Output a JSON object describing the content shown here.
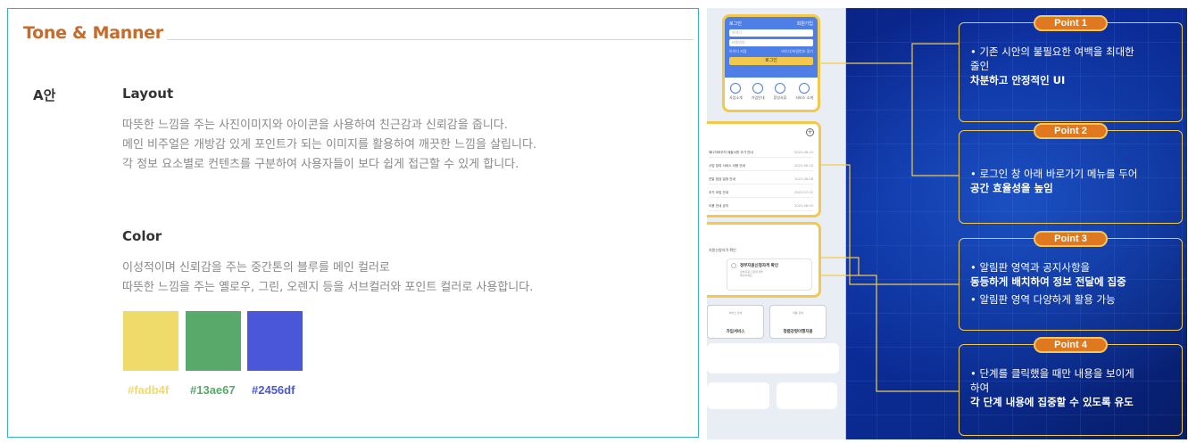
{
  "left": {
    "title": "Tone & Manner",
    "plan": "A안",
    "layout": {
      "heading": "Layout",
      "lines": [
        "따뜻한 느낌을 주는 사진이미지와 아이콘을 사용하여 친근감과 신뢰감을 줍니다.",
        "메인 비주얼은 개방감 있게 포인트가 되는 이미지를 활용하여 깨끗한 느낌을 살립니다.",
        "각 정보 요소별로 컨텐츠를 구분하여 사용자들이 보다 쉽게 접근할 수 있게 합니다."
      ]
    },
    "color": {
      "heading": "Color",
      "lines": [
        "이성적이며 신뢰감을 주는 중간톤의 블루를 메인 컬러로",
        "따뜻한 느낌을 주는 옐로우, 그린, 오렌지 등을 서브컬러와 포인트 컬러로 사용합니다."
      ],
      "swatches": [
        {
          "label": "#fadb4f",
          "color": "#efdb6a"
        },
        {
          "label": "#13ae67",
          "color": "#58a96a"
        },
        {
          "label": "#2456df",
          "color": "#4a57d9"
        }
      ]
    }
  },
  "right": {
    "login_card": {
      "title": "로그인",
      "signup": "회원가입",
      "id_placeholder": "아이디",
      "pw_placeholder": "비밀번호",
      "save_id": "아이디 저장",
      "find": "아이디/비밀번호 찾기",
      "login_button": "로그인",
      "shortcuts": [
        "사업소개",
        "가입안내",
        "증빙서류",
        "서비스 소개"
      ]
    },
    "notice_rows": [
      {
        "text": "에너지바우처 제출서류 추가 안내",
        "date": "2022-06-10"
      },
      {
        "text": "사업 참여 서비스 이용 안내",
        "date": "2022-06-10"
      },
      {
        "text": "연말 점검 일정 안내",
        "date": "2022-06-08"
      },
      {
        "text": "추가 모집 안내",
        "date": "2022-07-02"
      },
      {
        "text": "이용 안내 공지",
        "date": "2022-06-05"
      }
    ],
    "board": {
      "label": "지원신청자격 확인",
      "item_title": "정부지원신청자격 확인",
      "item_sub": [
        "정부지원 신청자격을",
        "확인하세요"
      ]
    },
    "services": [
      {
        "sub": "서비스 안내",
        "title": "가입서비스"
      },
      {
        "sub": "이용 안내",
        "title": "청렴강령이행지원"
      }
    ],
    "points": [
      {
        "label": "Point 1",
        "lines": [
          {
            "text": "• 기존 시안의 불필요한 여백을 최대한",
            "bold": false
          },
          {
            "text": "  줄인",
            "bold": false
          },
          {
            "text": "  차분하고 안정적인 UI",
            "bold": true
          }
        ]
      },
      {
        "label": "Point 2",
        "lines": [
          {
            "text": "• 로그인 창 아래 바로가기 메뉴를 두어",
            "bold": false
          },
          {
            "text": "  공간 효율성을 높임",
            "bold": false,
            "strong": "공간 효율성"
          }
        ]
      },
      {
        "label": "Point 3",
        "lines": [
          {
            "text": "• 알림판 영역과 공지사항을",
            "bold": false
          },
          {
            "text": "  동등하게 배치하여 정보 전달에 집중",
            "bold": false,
            "strong": "정보 전달에 집중"
          },
          {
            "text": "• 알림판 영역 다양하게 활용 가능",
            "bold": false
          }
        ]
      },
      {
        "label": "Point 4",
        "lines": [
          {
            "text": "• 단계를 클릭했을 때만 내용을 보이게",
            "bold": false,
            "strong": "클릭했을 때만 내용"
          },
          {
            "text": "  하여",
            "bold": false
          },
          {
            "text": "  각 단계 내용에 집중할 수 있도록 유도",
            "bold": false,
            "strong": "각 단계 내용에 집중"
          }
        ]
      }
    ]
  }
}
